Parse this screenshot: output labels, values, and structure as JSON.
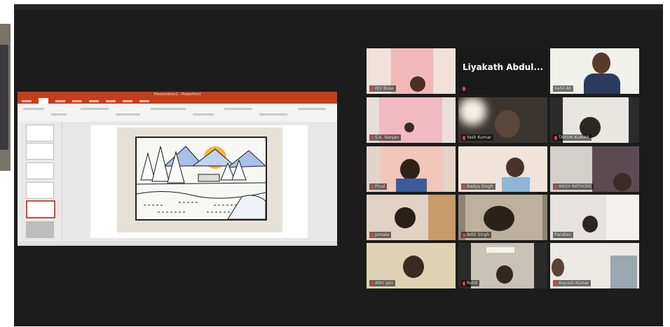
{
  "screen_share": {
    "window_title": "Presentation1 - PowerPoint"
  },
  "gallery": {
    "participants": [
      {
        "name": "RJV Bose",
        "muted": true
      },
      {
        "name": "Liyakath Abdul...",
        "muted": true
      },
      {
        "name": "Sahil Ali",
        "muted": false
      },
      {
        "name": "S.K. Ranjan",
        "muted": true
      },
      {
        "name": "Yash Kumar",
        "muted": true
      },
      {
        "name": "TARUN KUMAR",
        "muted": true
      },
      {
        "name": "Pinal",
        "muted": true
      },
      {
        "name": "Aadya Singh",
        "muted": true
      },
      {
        "name": "ANSH RATHORE",
        "muted": true
      },
      {
        "name": "Jamale",
        "muted": true
      },
      {
        "name": "Aditi Singh",
        "muted": true
      },
      {
        "name": "Pandian",
        "muted": false
      },
      {
        "name": "Abhi Jain",
        "muted": true
      },
      {
        "name": "Rohit",
        "muted": true
      },
      {
        "name": "Aayush Kumar",
        "muted": true
      }
    ]
  },
  "colors": {
    "meeting_bg": "#1c1c1c",
    "powerpoint_red": "#c43e1c",
    "active_speaker": "#b7d13a",
    "muted_icon": "#e0403a"
  }
}
